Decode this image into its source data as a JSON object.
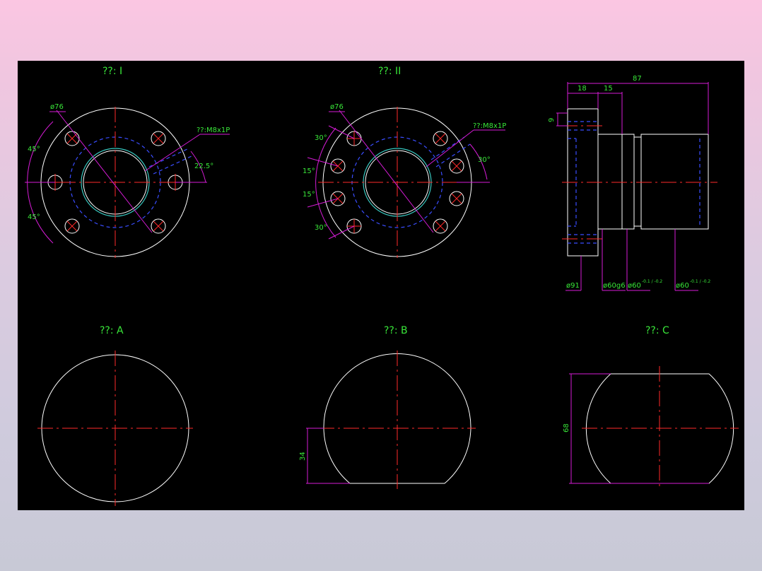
{
  "views": {
    "view1_title": "??: I",
    "view2_title": "??: II",
    "viewA_title": "??: A",
    "viewB_title": "??: B",
    "viewC_title": "??: C"
  },
  "dims": {
    "v1_dia": "ø76",
    "v1_thread": "??:M8x1P",
    "v1_ang_top": "45°",
    "v1_ang_bot": "45°",
    "v1_ang_right": "22.5°",
    "v2_dia": "ø76",
    "v2_thread": "??:M8x1P",
    "v2_ang_a": "30°",
    "v2_ang_b": "15°",
    "v2_ang_c": "15°",
    "v2_ang_d": "30°",
    "v2_ang_right": "30°",
    "side_total": "87",
    "side_flange": "18",
    "side_step": "15",
    "side_9": "9",
    "side_d91": "ø91",
    "side_d60g6": "ø60g6",
    "side_d60a": "ø60",
    "side_d60a_tol": "-0.1 / -0.2",
    "side_d60b": "ø60",
    "side_d60b_tol": "-0.1 / -0.2",
    "vB_34": "34",
    "vC_68": "68"
  },
  "colors": {
    "paper": "#000000",
    "outline": "#ffffff",
    "centerline": "#ff2a2a",
    "hidden": "#3a4dff",
    "dimension": "#d61cd6",
    "text": "#39e639"
  }
}
